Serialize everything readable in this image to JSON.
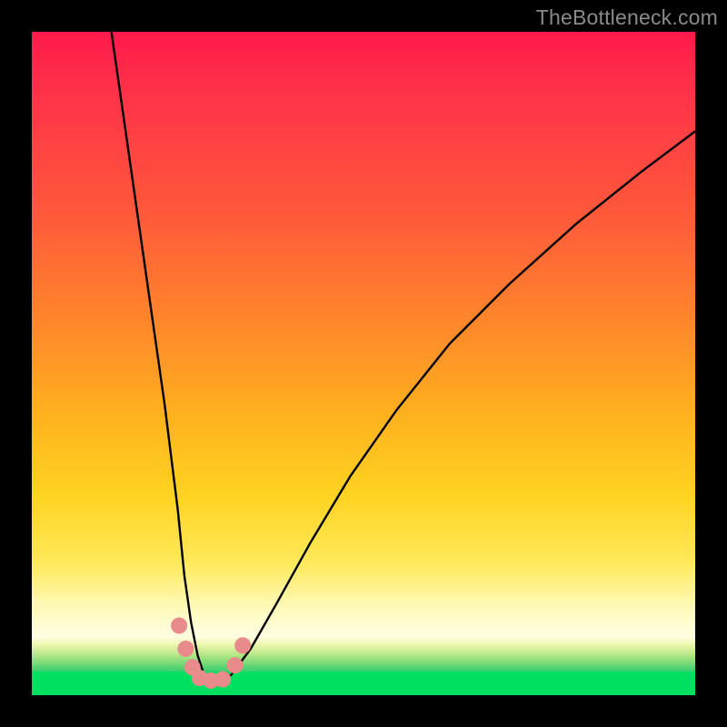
{
  "watermark": "TheBottleneck.com",
  "chart_data": {
    "type": "line",
    "title": "",
    "xlabel": "",
    "ylabel": "",
    "xlim": [
      0,
      100
    ],
    "ylim": [
      0,
      100
    ],
    "grid": false,
    "legend": false,
    "background_gradient": {
      "stops": [
        {
          "pos": 0.0,
          "color": "#ff1a4b"
        },
        {
          "pos": 0.45,
          "color": "#ff8a2a"
        },
        {
          "pos": 0.7,
          "color": "#ffd321"
        },
        {
          "pos": 0.88,
          "color": "#fffccf"
        },
        {
          "pos": 0.92,
          "color": "#c8f09a"
        },
        {
          "pos": 0.955,
          "color": "#4dd16f"
        },
        {
          "pos": 1.0,
          "color": "#00e060"
        }
      ]
    },
    "series": [
      {
        "name": "bottleneck-curve",
        "color": "#000000",
        "x": [
          12,
          14,
          16,
          18,
          20,
          22,
          23,
          24,
          25,
          26,
          27,
          28,
          30,
          33,
          37,
          42,
          48,
          55,
          63,
          72,
          82,
          92,
          100
        ],
        "y": [
          100,
          86,
          72,
          58,
          44,
          28,
          18,
          11,
          6,
          3,
          2,
          2,
          3,
          7,
          14,
          23,
          33,
          43,
          53,
          62,
          71,
          79,
          85
        ]
      }
    ],
    "markers": [
      {
        "name": "dot",
        "x": 22.2,
        "y": 10.5,
        "color": "#e98b8b"
      },
      {
        "name": "dot",
        "x": 23.2,
        "y": 7.0,
        "color": "#e98b8b"
      },
      {
        "name": "dot",
        "x": 24.2,
        "y": 4.2,
        "color": "#e98b8b"
      },
      {
        "name": "dot",
        "x": 25.3,
        "y": 2.6,
        "color": "#e98b8b"
      },
      {
        "name": "dot",
        "x": 27.0,
        "y": 2.2,
        "color": "#e98b8b"
      },
      {
        "name": "dot",
        "x": 28.8,
        "y": 2.4,
        "color": "#e98b8b"
      },
      {
        "name": "dot",
        "x": 30.6,
        "y": 4.5,
        "color": "#e98b8b"
      },
      {
        "name": "dot",
        "x": 31.8,
        "y": 7.5,
        "color": "#e98b8b"
      }
    ]
  }
}
